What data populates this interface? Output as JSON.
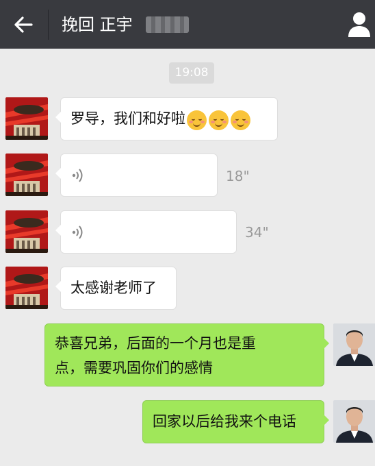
{
  "header": {
    "title": "挽回 正宇",
    "icons": {
      "back": "back-arrow-icon",
      "profile": "person-icon"
    }
  },
  "timestamp": "19:08",
  "messages": [
    {
      "side": "in",
      "type": "text",
      "text": "罗导，我们和好啦",
      "emoji_count": 3,
      "emoji": "blushing-smile"
    },
    {
      "side": "in",
      "type": "voice",
      "duration": "18\""
    },
    {
      "side": "in",
      "type": "voice",
      "duration": "34\""
    },
    {
      "side": "in",
      "type": "text",
      "text": "太感谢老师了"
    },
    {
      "side": "out",
      "type": "text",
      "lines": [
        "恭喜兄弟，后面的一个月也是重",
        "点，需要巩固你们的感情"
      ]
    },
    {
      "side": "out",
      "type": "text",
      "text": "回家以后给我来个电话"
    }
  ],
  "colors": {
    "header_bg": "#393a3f",
    "chat_bg": "#ebebeb",
    "incoming_bubble": "#ffffff",
    "outgoing_bubble": "#a0e75a",
    "duration_text": "#999999"
  }
}
